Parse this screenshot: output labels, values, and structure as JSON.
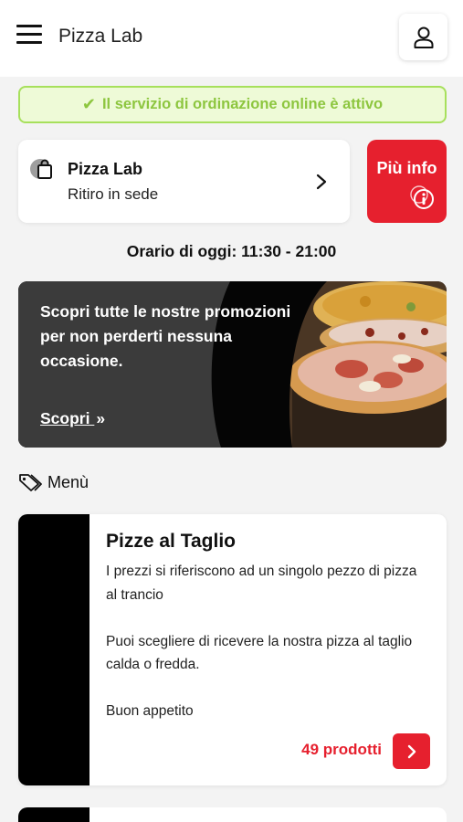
{
  "header": {
    "title": "Pizza Lab",
    "menu_icon": "hamburger-icon",
    "user_icon": "user-icon"
  },
  "status": {
    "text": "Il servizio di ordinazione online è attivo",
    "icon": "check-icon",
    "color": "#8dc63f"
  },
  "store": {
    "name": "Pizza Lab",
    "mode": "Ritiro in sede",
    "icon": "shopping-bag-icon"
  },
  "info_button": {
    "label": "Più info",
    "icon": "info-icon",
    "color": "#e6202e"
  },
  "hours": {
    "text": "Orario di oggi: 11:30 - 21:00"
  },
  "promo": {
    "text": "Scopri tutte le nostre promozioni per non perderti nessuna occasione.",
    "link_label": "Scopri",
    "link_icon": "double-chevron-right-icon"
  },
  "menu": {
    "heading": "Menù",
    "icon": "tag-icon"
  },
  "categories": [
    {
      "title": "Pizze al Taglio",
      "description": [
        "I prezzi si riferiscono ad un singolo pezzo di pizza al trancio",
        "Puoi scegliere di ricevere la nostra pizza al taglio calda o fredda.",
        "Buon appetito"
      ],
      "count_label": "49 prodotti"
    }
  ]
}
